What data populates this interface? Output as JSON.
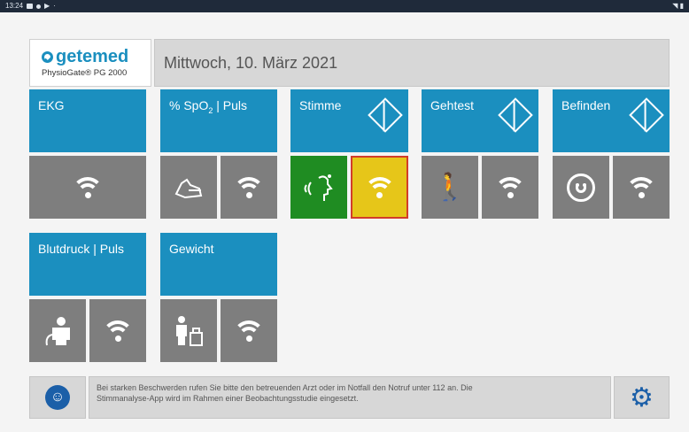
{
  "statusbar": {
    "time": "13:24"
  },
  "header": {
    "brand": "getemed",
    "product": "PhysioGate® PG 2000",
    "date": "Mittwoch, 10. März 2021"
  },
  "tiles": {
    "ekg": {
      "label": "EKG"
    },
    "spo2": {
      "label_pre": "% SpO",
      "label_sub": "2",
      "label_post": " | Puls"
    },
    "stimme": {
      "label": "Stimme"
    },
    "gehtest": {
      "label": "Gehtest"
    },
    "befinden": {
      "label": "Befinden"
    },
    "blutdruck": {
      "label": "Blutdruck | Puls"
    },
    "gewicht": {
      "label": "Gewicht"
    }
  },
  "footer": {
    "notice_line1": "Bei starken Beschwerden rufen Sie bitte den betreuenden Arzt oder im Notfall den Notruf unter 112 an. Die",
    "notice_line2": "Stimmanalyse-App wird im Rahmen einer Beobachtungsstudie eingesetzt."
  },
  "colors": {
    "tile_blue": "#1b8fbf",
    "button_gray": "#7e7e7e",
    "voice_green": "#1f8c22",
    "active_yellow": "#e6c619",
    "active_border": "#d23c2a",
    "settings_blue": "#1b5fa8"
  },
  "icons": [
    "wifi-icon",
    "finger-clip-icon",
    "voice-icon",
    "walking-icon",
    "smiley-icon",
    "blood-pressure-icon",
    "scale-icon",
    "info-person-icon",
    "gear-icon",
    "diamond-icon"
  ]
}
